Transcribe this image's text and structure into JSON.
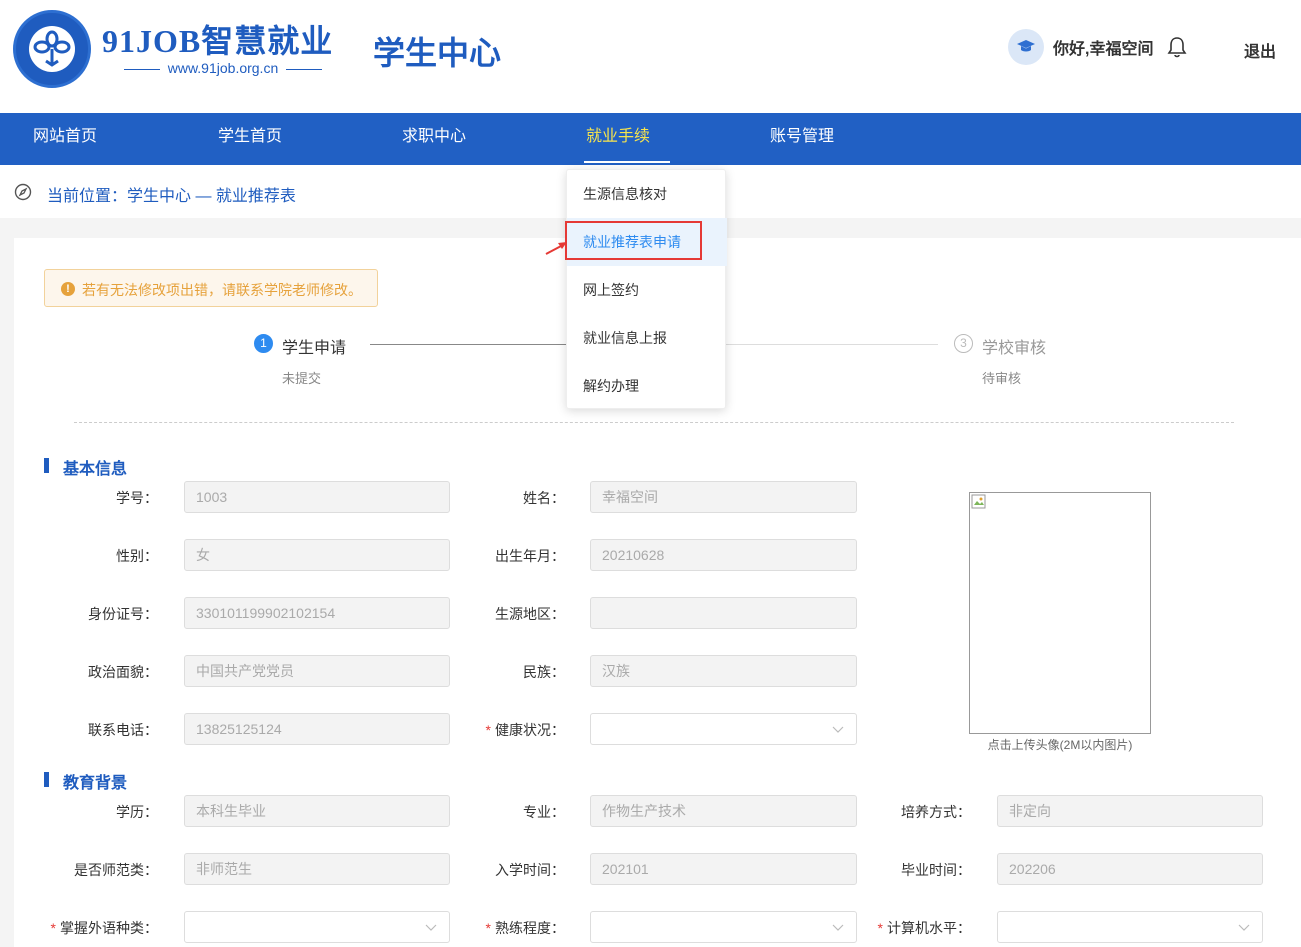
{
  "header": {
    "logo_title": "91JOB智慧就业",
    "logo_url": "www.91job.org.cn",
    "logo_ring": "91Job智慧就业",
    "center_title": "学生中心",
    "greeting": "你好,幸福空间",
    "logout": "退出"
  },
  "nav": {
    "items": [
      "网站首页",
      "学生首页",
      "求职中心",
      "就业手续",
      "账号管理"
    ]
  },
  "breadcrumb": "当前位置：学生中心 — 就业推荐表",
  "dropdown": {
    "items": [
      "生源信息核对",
      "就业推荐表申请",
      "网上签约",
      "就业信息上报",
      "解约办理"
    ]
  },
  "alert": "若有无法修改项出错，请联系学院老师修改。",
  "steps": [
    {
      "num": "1",
      "title": "学生申请",
      "desc": "未提交"
    },
    {
      "num": "3",
      "title": "学校审核",
      "desc": "待审核"
    }
  ],
  "sections": {
    "basic": "基本信息",
    "education": "教育背景"
  },
  "basic": {
    "student_id_label": "学号：",
    "student_id": "1003",
    "name_label": "姓名：",
    "name": "幸福空间",
    "gender_label": "性别：",
    "gender": "女",
    "birth_label": "出生年月：",
    "birth": "20210628",
    "idcard_label": "身份证号：",
    "idcard": "330101199902102154",
    "origin_label": "生源地区：",
    "origin": "",
    "political_label": "政治面貌：",
    "political": "中国共产党党员",
    "ethnic_label": "民族：",
    "ethnic": "汉族",
    "phone_label": "联系电话：",
    "phone": "13825125124",
    "health_label": "健康状况：",
    "health": ""
  },
  "photo_caption": "点击上传头像(2M以内图片)",
  "education": {
    "degree_label": "学历：",
    "degree": "本科生毕业",
    "major_label": "专业：",
    "major": "作物生产技术",
    "train_label": "培养方式：",
    "train": "非定向",
    "normal_label": "是否师范类：",
    "normal": "非师范生",
    "enroll_label": "入学时间：",
    "enroll": "202101",
    "grad_label": "毕业时间：",
    "grad": "202206",
    "lang_label": "掌握外语种类：",
    "prof_label": "熟练程度：",
    "computer_label": "计算机水平："
  },
  "colors": {
    "brand": "#1f5cbf",
    "nav_bg": "#2160c4",
    "nav_active": "#f6e44e",
    "alert": "#e6a23c",
    "highlight": "#e53935"
  }
}
